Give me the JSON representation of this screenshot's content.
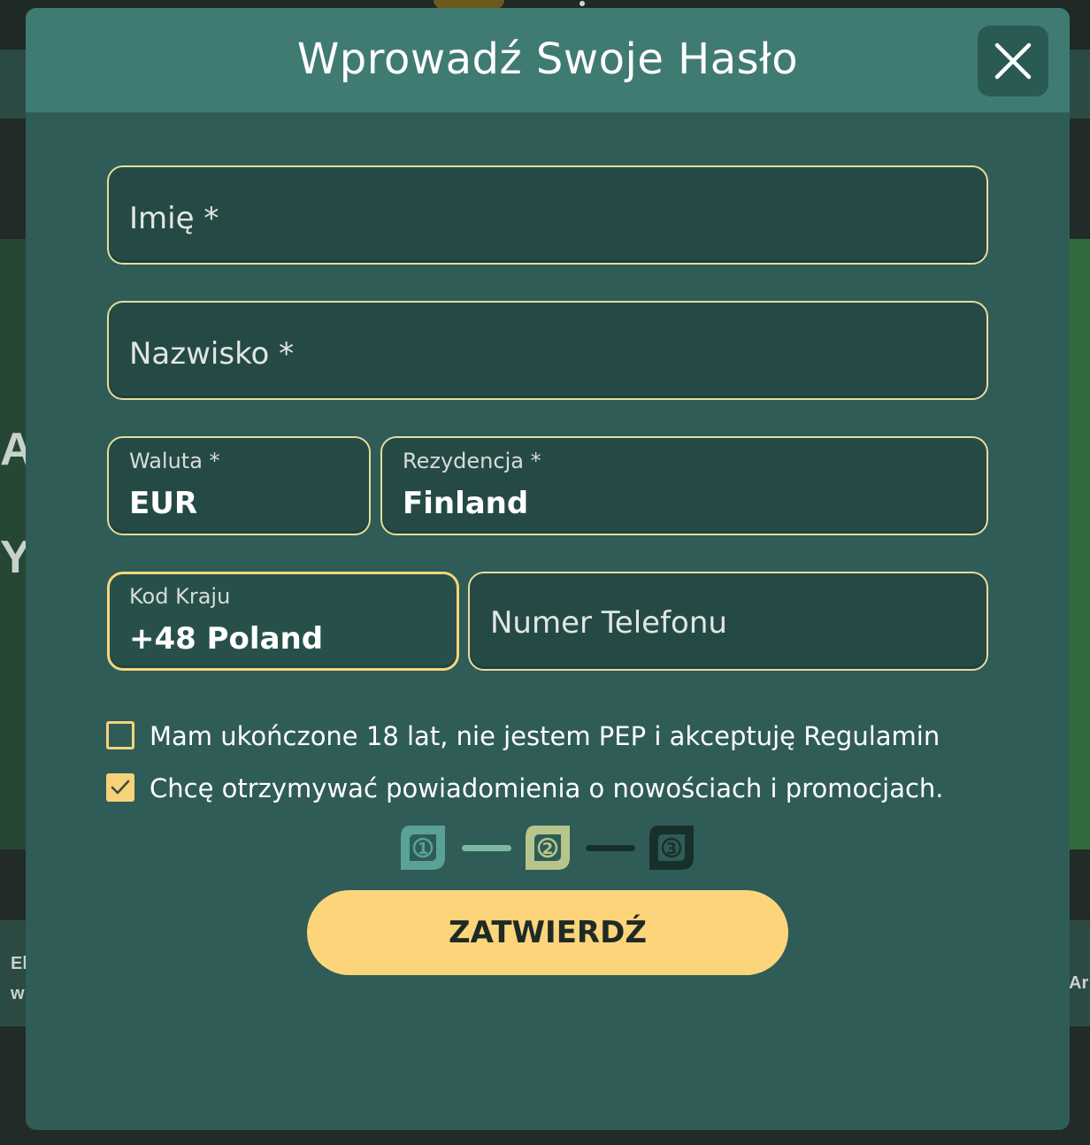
{
  "background": {
    "hero_text_line1": "AL",
    "hero_text_line2": "Y",
    "strip_left_line1": "El",
    "strip_left_line2": "w",
    "strip_right": "Ar"
  },
  "modal": {
    "title": "Wprowadź Swoje Hasło",
    "close_icon": "close-icon"
  },
  "form": {
    "first_name": {
      "placeholder": "Imię *"
    },
    "last_name": {
      "placeholder": "Nazwisko *"
    },
    "currency": {
      "label": "Waluta *",
      "value": "EUR"
    },
    "residence": {
      "label": "Rezydencja *",
      "value": "Finland"
    },
    "country_code": {
      "label": "Kod Kraju",
      "value": "+48 Poland"
    },
    "phone": {
      "placeholder": "Numer Telefonu"
    },
    "checkboxes": [
      {
        "label": "Mam ukończone 18 lat, nie jestem PEP i akceptuję Regulamin",
        "checked": false
      },
      {
        "label": "Chcę otrzymywać powiadomienia o nowościach i promocjach.",
        "checked": true
      }
    ],
    "steps": [
      {
        "number": "1",
        "color": "#5aa196"
      },
      {
        "number": "2",
        "color": "#b7c58d"
      },
      {
        "number": "3",
        "color": "#18302b"
      }
    ],
    "submit_label": "ZATWIERDŹ"
  },
  "colors": {
    "accent": "#fcd57a",
    "modal_bg": "#2f5c56",
    "header_bg": "#3f7b73"
  }
}
